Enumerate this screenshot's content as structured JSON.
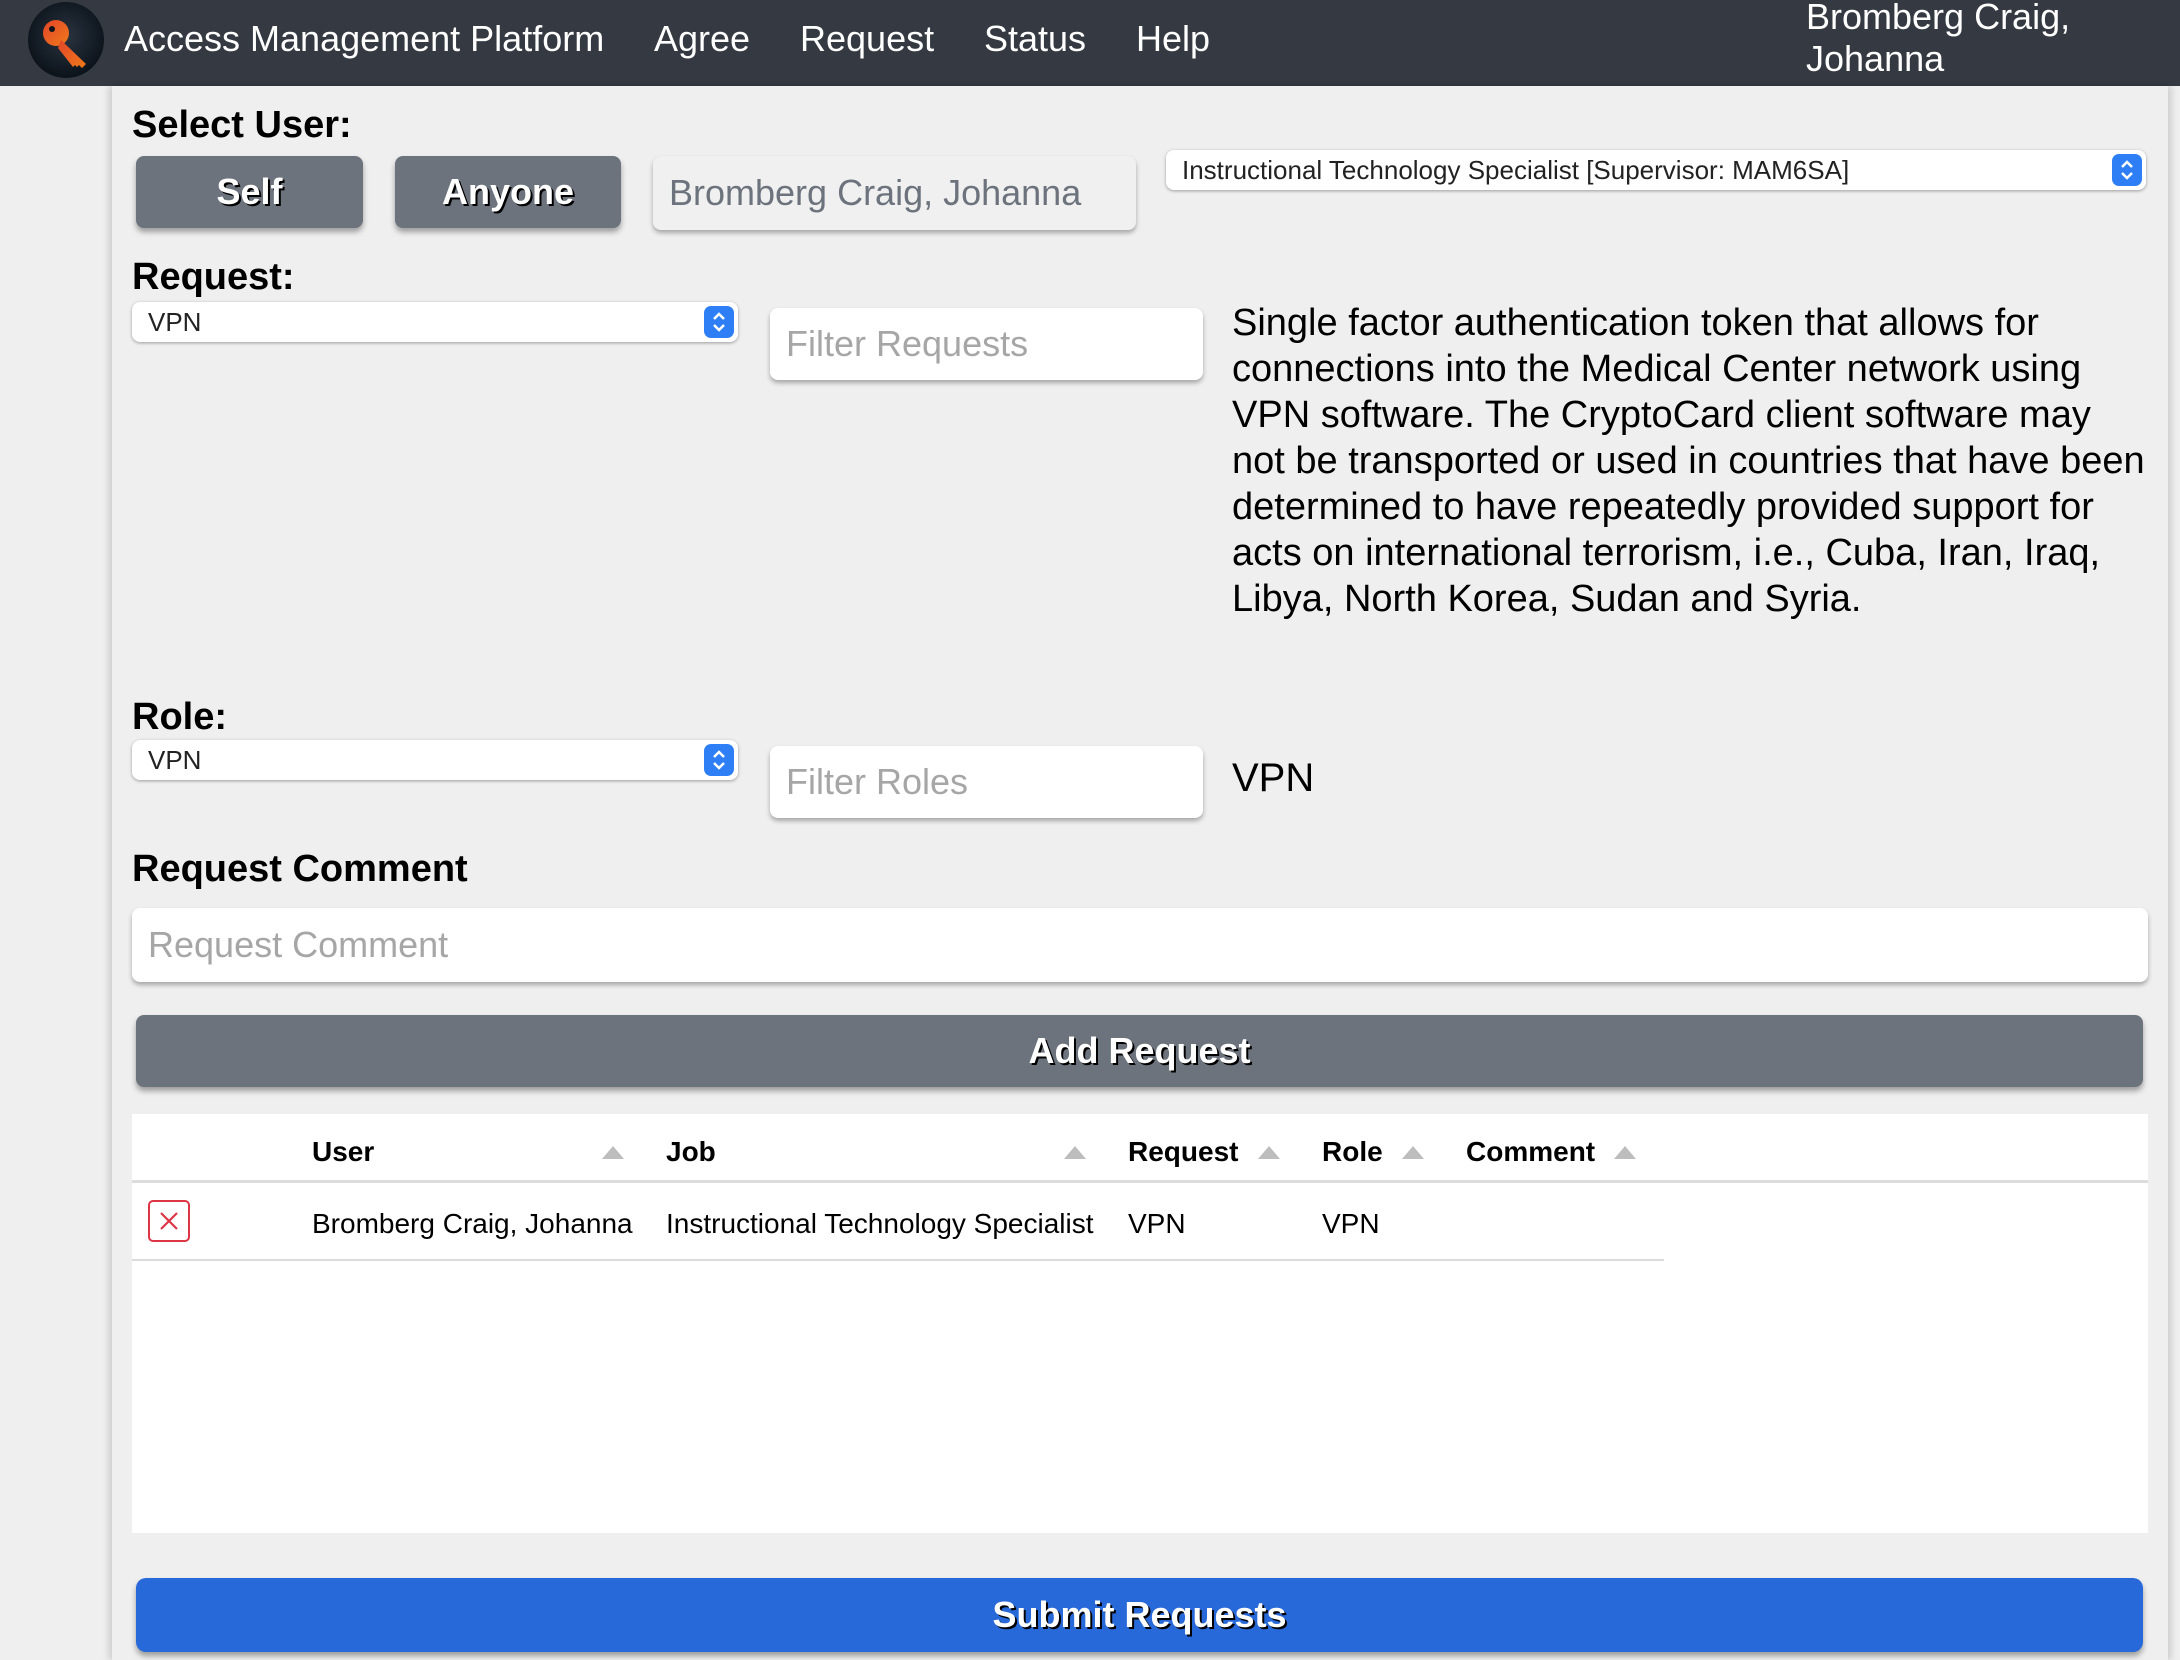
{
  "header": {
    "logo_icon": "key-icon",
    "brand": "Access Management Platform",
    "nav": [
      {
        "label": "Agree"
      },
      {
        "label": "Request"
      },
      {
        "label": "Status"
      },
      {
        "label": "Help"
      }
    ],
    "user_line1": "Bromberg Craig,",
    "user_line2": "Johanna"
  },
  "select_user": {
    "label": "Select User:",
    "self_label": "Self",
    "anyone_label": "Anyone",
    "user_value": "Bromberg Craig, Johanna",
    "job_selected": "Instructional Technology Specialist [Supervisor: MAM6SA]"
  },
  "request": {
    "label": "Request:",
    "selected": "VPN",
    "filter_placeholder": "Filter Requests",
    "description": "Single factor authentication token that allows for connections into the Medical Center network using VPN software. The CryptoCard client software may not be transported or used in countries that have been determined to have repeatedly provided support for acts on international terrorism, i.e., Cuba, Iran, Iraq, Libya, North Korea, Sudan and Syria."
  },
  "role": {
    "label": "Role:",
    "selected": "VPN",
    "filter_placeholder": "Filter Roles",
    "description": "VPN"
  },
  "comment": {
    "label": "Request Comment",
    "placeholder": "Request Comment",
    "value": ""
  },
  "add_request_label": "Add Request",
  "table": {
    "columns": [
      {
        "label": "User",
        "sort": "ascending"
      },
      {
        "label": "Job",
        "sort": "ascending"
      },
      {
        "label": "Request",
        "sort": "ascending"
      },
      {
        "label": "Role",
        "sort": "ascending"
      },
      {
        "label": "Comment",
        "sort": "ascending"
      }
    ],
    "rows": [
      {
        "delete_icon": "close-icon",
        "user": "Bromberg Craig, Johanna",
        "job": "Instructional Technology Specialist",
        "request": "VPN",
        "role": "VPN",
        "comment": ""
      }
    ]
  },
  "submit_label": "Submit Requests",
  "colors": {
    "header_bg": "#353a42",
    "gray_button": "#6c737d",
    "submit_button": "#2869d9",
    "delete_red": "#dc3545",
    "select_stepper": "#2e7ff6"
  }
}
